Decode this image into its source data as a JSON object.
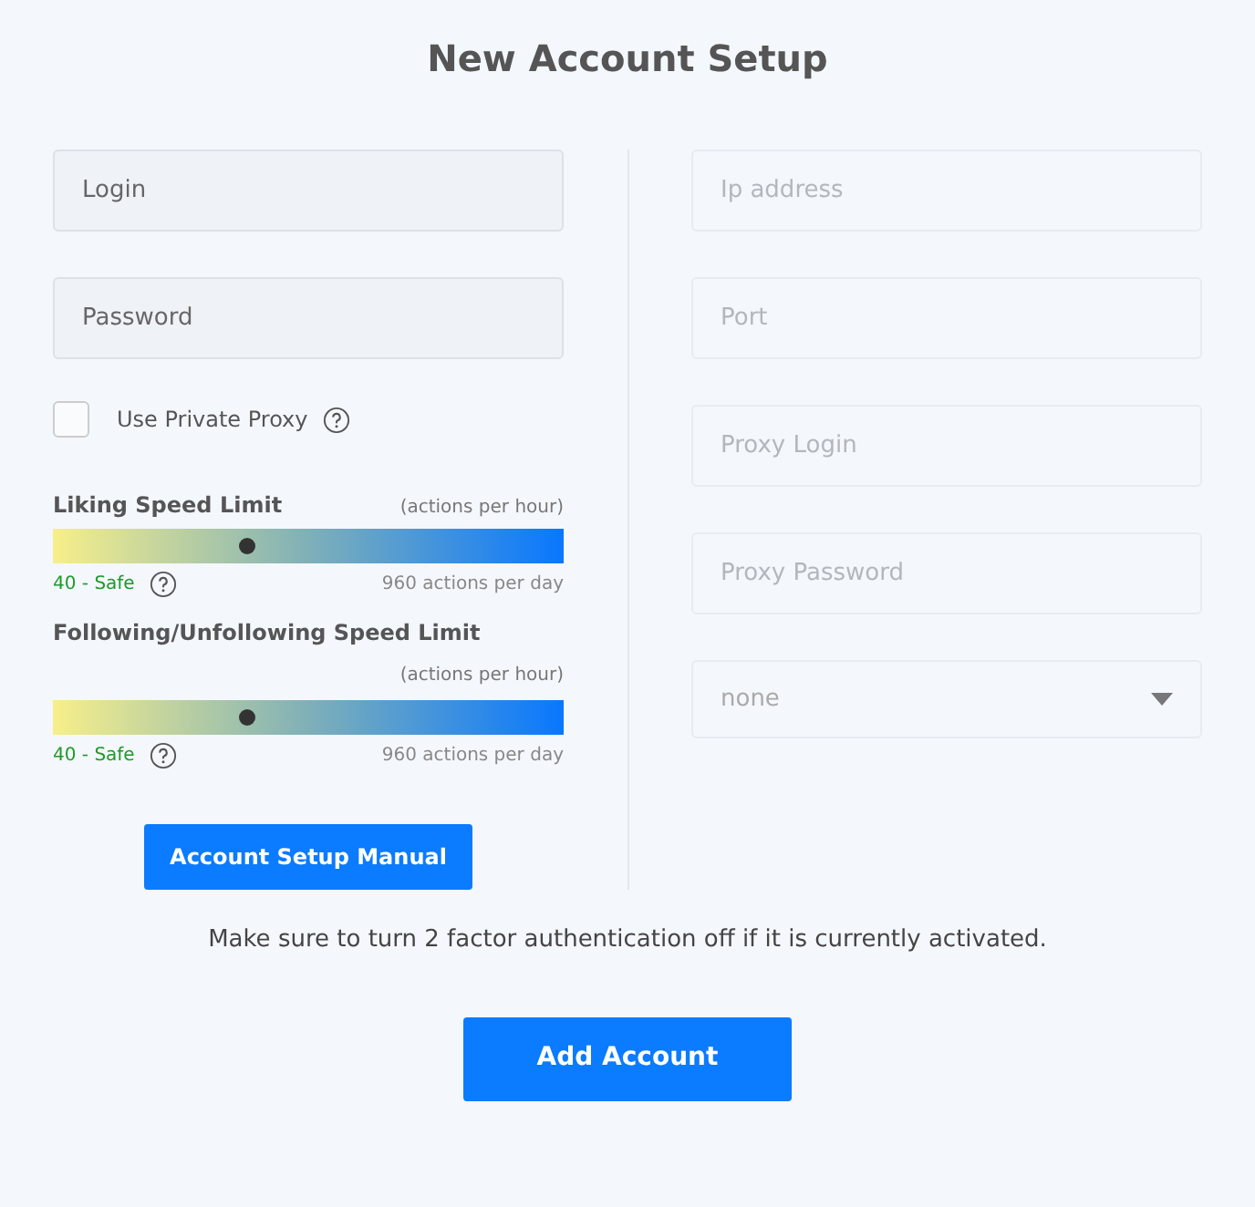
{
  "title": "New Account Setup",
  "left_fields": [
    {
      "placeholder": "Login",
      "disabled": false
    },
    {
      "placeholder": "Password",
      "disabled": false
    }
  ],
  "proxy_checkbox": {
    "label": "Use Private Proxy",
    "checked": false
  },
  "speed_limits": [
    {
      "label": "Liking Speed Limit",
      "unit": "(actions per hour)",
      "level": 0.38,
      "reading": "40 - Safe",
      "per_day": "960 actions per day",
      "unit_wrapped": false
    },
    {
      "label": "Following/Unfollowing Speed Limit",
      "unit": "(actions per hour)",
      "level": 0.38,
      "reading": "40 - Safe",
      "per_day": "960 actions per day",
      "unit_wrapped": true
    }
  ],
  "manual_button": "Account Setup Manual",
  "right_fields": [
    {
      "kind": "input",
      "placeholder": "Ip address",
      "disabled": true
    },
    {
      "kind": "input",
      "placeholder": "Port",
      "disabled": true
    },
    {
      "kind": "input",
      "placeholder": "Proxy Login",
      "disabled": true
    },
    {
      "kind": "input",
      "placeholder": "Proxy Password",
      "disabled": true
    },
    {
      "kind": "select",
      "value": "none",
      "disabled": true
    }
  ],
  "notice": "Make sure to turn 2 factor authentication off if it is currently activated.",
  "submit_button": "Add Account"
}
